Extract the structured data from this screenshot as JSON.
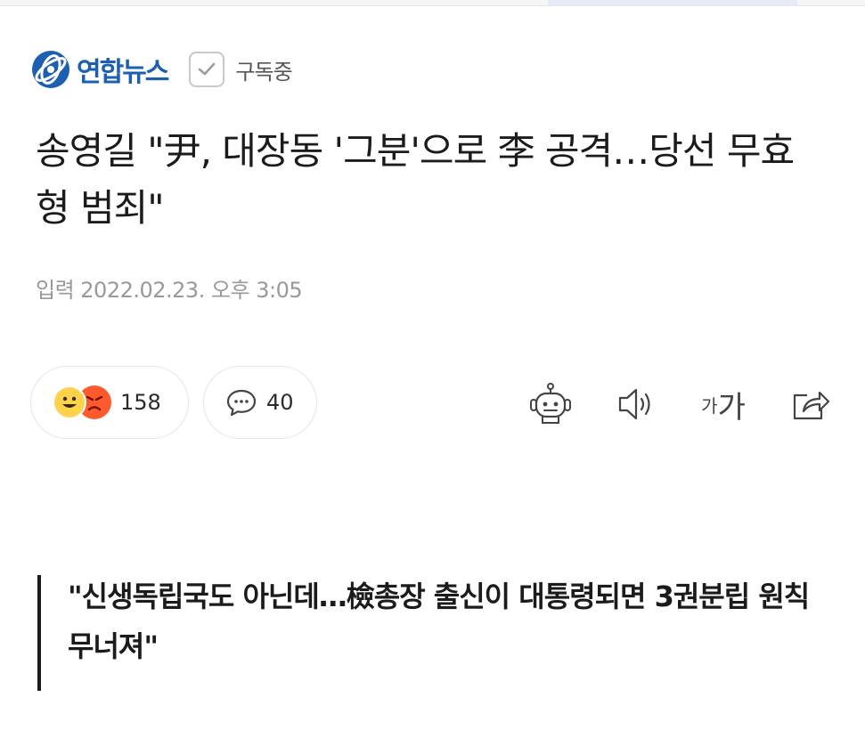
{
  "press": {
    "name": "연합뉴스",
    "subscribe_label": "구독중",
    "brand_color": "#1d5fb0",
    "logo_icon": "yonhap-logo-icon",
    "subscribe_icon": "check-icon"
  },
  "article": {
    "headline": "송영길 \"尹, 대장동 '그분'으로 李 공격…당선 무효형 범죄\"",
    "date": "입력 2022.02.23. 오후 3:05",
    "subheading": "\"신생독립국도 아닌데…檢총장 출신이 대통령되면 3권분립 원칙 무너져\""
  },
  "reactions": {
    "count": "158",
    "icons": [
      "happy-emoji-icon",
      "angry-emoji-icon"
    ]
  },
  "comments": {
    "count": "40",
    "icon": "comment-bubble-icon"
  },
  "toolbar": {
    "font_small": "가",
    "font_large": "가",
    "icons": [
      "summary-bot-icon",
      "speaker-icon",
      "font-size-icon",
      "share-icon"
    ]
  }
}
